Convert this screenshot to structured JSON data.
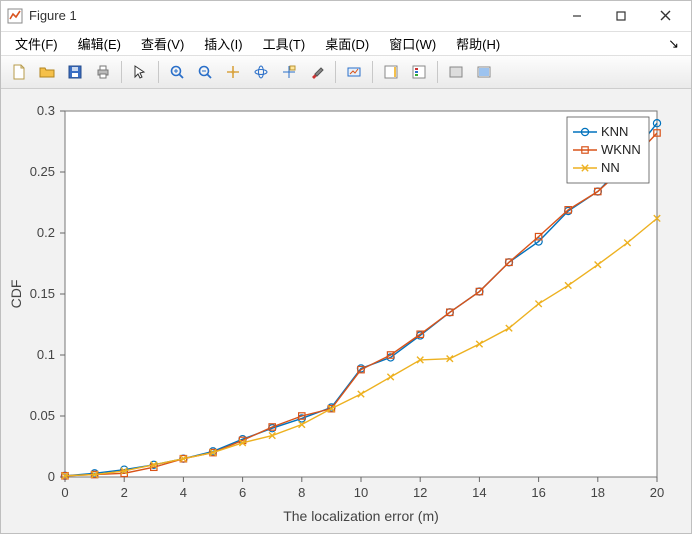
{
  "window": {
    "title": "Figure 1"
  },
  "menu": {
    "items": [
      "文件(F)",
      "编辑(E)",
      "查看(V)",
      "插入(I)",
      "工具(T)",
      "桌面(D)",
      "窗口(W)",
      "帮助(H)"
    ]
  },
  "toolbar_icons": [
    "new-file-icon",
    "open-folder-icon",
    "save-icon",
    "print-icon",
    "sep",
    "pointer-icon",
    "sep",
    "zoom-in-icon",
    "zoom-out-icon",
    "pan-icon",
    "rotate3d-icon",
    "data-cursor-icon",
    "brush-icon",
    "sep",
    "link-data-icon",
    "sep",
    "colorbar-icon",
    "legend-icon",
    "sep",
    "hide-plot-icon",
    "show-plot-icon"
  ],
  "chart_data": {
    "type": "line",
    "xlabel": "The localization error (m)",
    "ylabel": "CDF",
    "xlim": [
      0,
      20
    ],
    "ylim": [
      0,
      0.3
    ],
    "xticks": [
      0,
      2,
      4,
      6,
      8,
      10,
      12,
      14,
      16,
      18,
      20
    ],
    "yticks": [
      0,
      0.05,
      0.1,
      0.15,
      0.2,
      0.25,
      0.3
    ],
    "x": [
      0,
      1,
      2,
      3,
      4,
      5,
      6,
      7,
      8,
      9,
      10,
      11,
      12,
      13,
      14,
      15,
      16,
      17,
      18,
      19,
      20
    ],
    "series": [
      {
        "name": "KNN",
        "color": "#0072bd",
        "marker": "o",
        "values": [
          0.001,
          0.003,
          0.006,
          0.01,
          0.015,
          0.021,
          0.031,
          0.04,
          0.048,
          0.057,
          0.089,
          0.098,
          0.116,
          0.135,
          0.152,
          0.176,
          0.193,
          0.218,
          0.234,
          0.259,
          0.29
        ]
      },
      {
        "name": "WKNN",
        "color": "#d95319",
        "marker": "s",
        "values": [
          0.001,
          0.002,
          0.003,
          0.008,
          0.015,
          0.02,
          0.03,
          0.041,
          0.05,
          0.056,
          0.088,
          0.1,
          0.117,
          0.135,
          0.152,
          0.176,
          0.197,
          0.219,
          0.234,
          0.256,
          0.282
        ]
      },
      {
        "name": "NN",
        "color": "#edb120",
        "marker": "x",
        "values": [
          0.001,
          0.002,
          0.005,
          0.01,
          0.015,
          0.02,
          0.028,
          0.034,
          0.043,
          0.056,
          0.068,
          0.082,
          0.096,
          0.097,
          0.109,
          0.122,
          0.142,
          0.157,
          0.174,
          0.192,
          0.212
        ]
      }
    ],
    "legend_position": "northeast"
  }
}
